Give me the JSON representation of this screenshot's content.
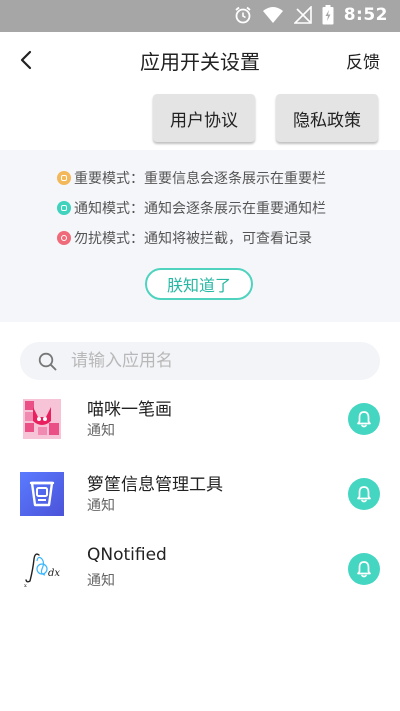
{
  "status_bar": {
    "time": "8:52"
  },
  "header": {
    "title": "应用开关设置",
    "feedback": "反馈"
  },
  "actions": {
    "agreement": "用户协议",
    "privacy": "隐私政策"
  },
  "modes": [
    {
      "text": "重要模式：重要信息会逐条展示在重要栏",
      "color": "#f2b85a"
    },
    {
      "text": "通知模式：通知会逐条展示在重要通知栏",
      "color": "#3fd2bd"
    },
    {
      "text": "勿扰模式：通知将被拦截，可查看记录",
      "color": "#ef6b7a"
    }
  ],
  "got_it": "朕知道了",
  "search": {
    "placeholder": "请输入应用名"
  },
  "apps": [
    {
      "name": "喵咪一笔画",
      "mode": "通知",
      "icon": "cat-drawing-app-icon"
    },
    {
      "name": "箩筐信息管理工具",
      "mode": "通知",
      "icon": "basket-app-icon"
    },
    {
      "name": "QNotified",
      "mode": "通知",
      "icon": "integral-app-icon"
    }
  ],
  "colors": {
    "accent": "#45d6c2",
    "panel_bg": "#f5f6fa",
    "status_bar": "#a6a6a6"
  }
}
